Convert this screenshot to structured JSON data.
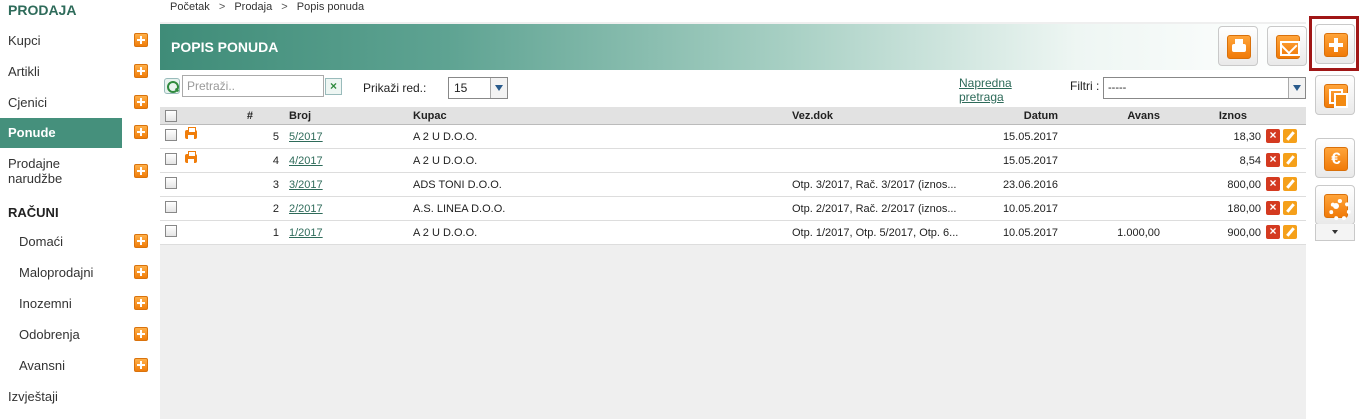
{
  "sidebar": {
    "section1": "PRODAJA",
    "section2": "RAČUNI",
    "items": [
      {
        "label": "Kupci"
      },
      {
        "label": "Artikli"
      },
      {
        "label": "Cjenici"
      },
      {
        "label": "Ponude"
      },
      {
        "label": "Prodajne narudžbe"
      }
    ],
    "racuni_items": [
      {
        "label": "Domaći"
      },
      {
        "label": "Maloprodajni"
      },
      {
        "label": "Inozemni"
      },
      {
        "label": "Odobrenja"
      },
      {
        "label": "Avansni"
      }
    ],
    "reports": "Izvještaji"
  },
  "breadcrumb": [
    "Početak",
    ">",
    "Prodaja",
    ">",
    "Popis ponuda"
  ],
  "page_title": "POPIS PONUDA",
  "toolbar": {
    "search_placeholder": "Pretraži..",
    "clear": "×",
    "rows_label": "Prikaži red.:",
    "rows_value": "15",
    "advanced_search": "Napredna pretraga",
    "filter_label": "Filtri :",
    "filter_value": "-----"
  },
  "table": {
    "columns": [
      "#",
      "Broj",
      "Kupac",
      "Vez.dok",
      "Datum",
      "Avans",
      "Iznos"
    ],
    "rows": [
      {
        "num": "5",
        "broj": "5/2017",
        "kupac": "A 2 U D.O.O.",
        "vez": "",
        "datum": "15.05.2017",
        "avans": "",
        "iznos": "18,30",
        "printed": true
      },
      {
        "num": "4",
        "broj": "4/2017",
        "kupac": "A 2 U D.O.O.",
        "vez": "",
        "datum": "15.05.2017",
        "avans": "",
        "iznos": "8,54",
        "printed": true
      },
      {
        "num": "3",
        "broj": "3/2017",
        "kupac": "ADS TONI D.O.O.",
        "vez": "Otp. 3/2017, Rač. 3/2017 (iznos...",
        "datum": "23.06.2016",
        "avans": "",
        "iznos": "800,00",
        "printed": false
      },
      {
        "num": "2",
        "broj": "2/2017",
        "kupac": "A.S. LINEA D.O.O.",
        "vez": "Otp. 2/2017, Rač. 2/2017 (iznos...",
        "datum": "10.05.2017",
        "avans": "",
        "iznos": "180,00",
        "printed": false
      },
      {
        "num": "1",
        "broj": "1/2017",
        "kupac": "A 2 U D.O.O.",
        "vez": "Otp. 1/2017, Otp. 5/2017, Otp. 6...",
        "datum": "10.05.2017",
        "avans": "1.000,00",
        "iznos": "900,00",
        "printed": false
      }
    ]
  },
  "actions": {
    "euro": "€"
  },
  "colors": {
    "brand_green": "#45907c",
    "accent_orange": "#f07d0a",
    "highlight_red": "#a01616"
  }
}
